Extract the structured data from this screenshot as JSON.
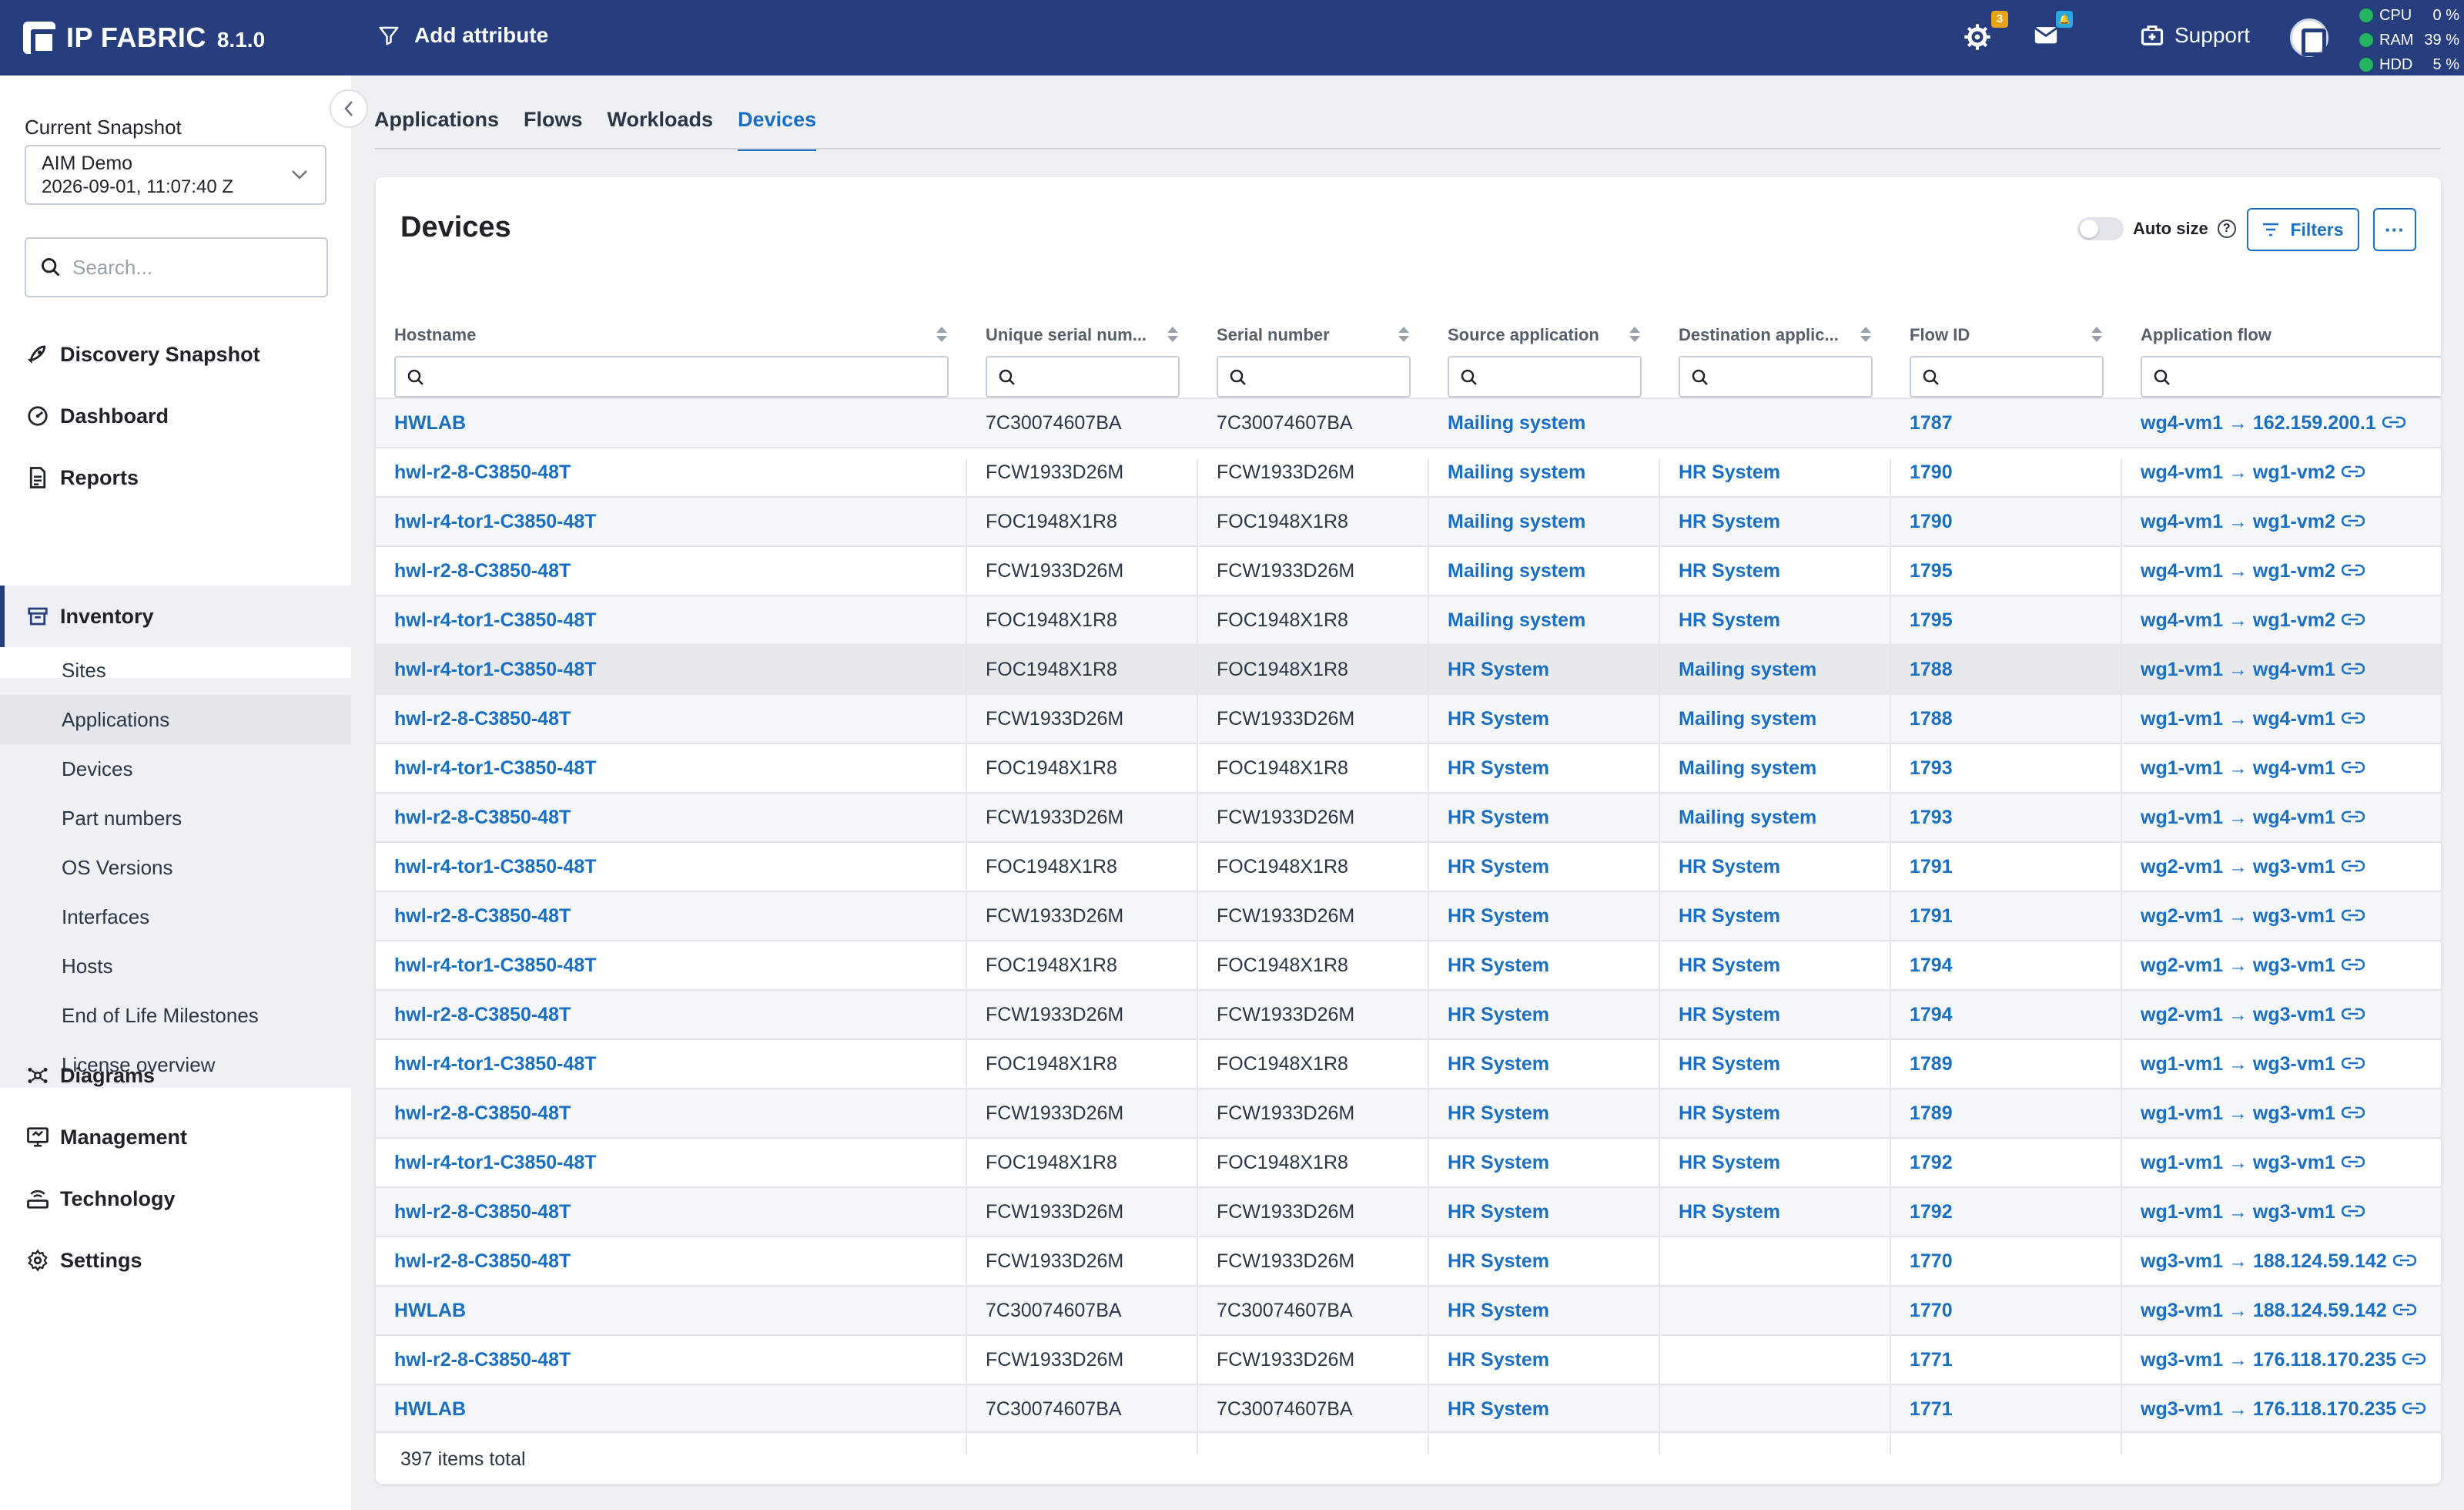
{
  "app": {
    "name": "IP FABRIC",
    "version": "8.1.0",
    "add_attribute": "Add attribute",
    "support": "Support",
    "settings_badge": "3",
    "messages_badge": "🔔",
    "stats": [
      {
        "label": "CPU",
        "value": "0 %"
      },
      {
        "label": "RAM",
        "value": "39 %"
      },
      {
        "label": "HDD",
        "value": "5 %"
      }
    ]
  },
  "sidebar": {
    "snapshot_label": "Current Snapshot",
    "snapshot_name": "AIM Demo",
    "snapshot_date": "2026-09-01, 11:07:40 Z",
    "search_placeholder": "Search...",
    "nav": [
      {
        "label": "Discovery Snapshot",
        "icon": "rocket-icon"
      },
      {
        "label": "Dashboard",
        "icon": "dashboard-icon"
      },
      {
        "label": "Reports",
        "icon": "report-icon"
      },
      {
        "label": "Inventory",
        "icon": "archive-icon"
      },
      {
        "label": "Diagrams",
        "icon": "diagram-icon"
      },
      {
        "label": "Management",
        "icon": "monitor-icon"
      },
      {
        "label": "Technology",
        "icon": "router-icon"
      },
      {
        "label": "Settings",
        "icon": "gear-icon"
      }
    ],
    "inventory_items": [
      "Sites",
      "Applications",
      "Devices",
      "Part numbers",
      "OS Versions",
      "Interfaces",
      "Hosts",
      "End of Life Milestones",
      "License overview"
    ]
  },
  "tabs": [
    "Applications",
    "Flows",
    "Workloads",
    "Devices"
  ],
  "card": {
    "title": "Devices",
    "auto_size": "Auto size",
    "filters": "Filters",
    "more": "···",
    "footer": "397 items total"
  },
  "table": {
    "columns": [
      "Hostname",
      "Unique serial num...",
      "Serial number",
      "Source application",
      "Destination applic...",
      "Flow ID",
      "Application flow"
    ],
    "rows": [
      [
        "HWLAB",
        "7C30074607BA",
        "7C30074607BA",
        "Mailing system",
        "",
        "1787",
        "wg4-vm1 → 162.159.200.1"
      ],
      [
        "hwl-r2-8-C3850-48T",
        "FCW1933D26M",
        "FCW1933D26M",
        "Mailing system",
        "HR System",
        "1790",
        "wg4-vm1 → wg1-vm2"
      ],
      [
        "hwl-r4-tor1-C3850-48T",
        "FOC1948X1R8",
        "FOC1948X1R8",
        "Mailing system",
        "HR System",
        "1790",
        "wg4-vm1 → wg1-vm2"
      ],
      [
        "hwl-r2-8-C3850-48T",
        "FCW1933D26M",
        "FCW1933D26M",
        "Mailing system",
        "HR System",
        "1795",
        "wg4-vm1 → wg1-vm2"
      ],
      [
        "hwl-r4-tor1-C3850-48T",
        "FOC1948X1R8",
        "FOC1948X1R8",
        "Mailing system",
        "HR System",
        "1795",
        "wg4-vm1 → wg1-vm2"
      ],
      [
        "hwl-r4-tor1-C3850-48T",
        "FOC1948X1R8",
        "FOC1948X1R8",
        "HR System",
        "Mailing system",
        "1788",
        "wg1-vm1 → wg4-vm1"
      ],
      [
        "hwl-r2-8-C3850-48T",
        "FCW1933D26M",
        "FCW1933D26M",
        "HR System",
        "Mailing system",
        "1788",
        "wg1-vm1 → wg4-vm1"
      ],
      [
        "hwl-r4-tor1-C3850-48T",
        "FOC1948X1R8",
        "FOC1948X1R8",
        "HR System",
        "Mailing system",
        "1793",
        "wg1-vm1 → wg4-vm1"
      ],
      [
        "hwl-r2-8-C3850-48T",
        "FCW1933D26M",
        "FCW1933D26M",
        "HR System",
        "Mailing system",
        "1793",
        "wg1-vm1 → wg4-vm1"
      ],
      [
        "hwl-r4-tor1-C3850-48T",
        "FOC1948X1R8",
        "FOC1948X1R8",
        "HR System",
        "HR System",
        "1791",
        "wg2-vm1 → wg3-vm1"
      ],
      [
        "hwl-r2-8-C3850-48T",
        "FCW1933D26M",
        "FCW1933D26M",
        "HR System",
        "HR System",
        "1791",
        "wg2-vm1 → wg3-vm1"
      ],
      [
        "hwl-r4-tor1-C3850-48T",
        "FOC1948X1R8",
        "FOC1948X1R8",
        "HR System",
        "HR System",
        "1794",
        "wg2-vm1 → wg3-vm1"
      ],
      [
        "hwl-r2-8-C3850-48T",
        "FCW1933D26M",
        "FCW1933D26M",
        "HR System",
        "HR System",
        "1794",
        "wg2-vm1 → wg3-vm1"
      ],
      [
        "hwl-r4-tor1-C3850-48T",
        "FOC1948X1R8",
        "FOC1948X1R8",
        "HR System",
        "HR System",
        "1789",
        "wg1-vm1 → wg3-vm1"
      ],
      [
        "hwl-r2-8-C3850-48T",
        "FCW1933D26M",
        "FCW1933D26M",
        "HR System",
        "HR System",
        "1789",
        "wg1-vm1 → wg3-vm1"
      ],
      [
        "hwl-r4-tor1-C3850-48T",
        "FOC1948X1R8",
        "FOC1948X1R8",
        "HR System",
        "HR System",
        "1792",
        "wg1-vm1 → wg3-vm1"
      ],
      [
        "hwl-r2-8-C3850-48T",
        "FCW1933D26M",
        "FCW1933D26M",
        "HR System",
        "HR System",
        "1792",
        "wg1-vm1 → wg3-vm1"
      ],
      [
        "hwl-r2-8-C3850-48T",
        "FCW1933D26M",
        "FCW1933D26M",
        "HR System",
        "",
        "1770",
        "wg3-vm1 → 188.124.59.142"
      ],
      [
        "HWLAB",
        "7C30074607BA",
        "7C30074607BA",
        "HR System",
        "",
        "1770",
        "wg3-vm1 → 188.124.59.142"
      ],
      [
        "hwl-r2-8-C3850-48T",
        "FCW1933D26M",
        "FCW1933D26M",
        "HR System",
        "",
        "1771",
        "wg3-vm1 → 176.118.170.235"
      ],
      [
        "HWLAB",
        "7C30074607BA",
        "7C30074607BA",
        "HR System",
        "",
        "1771",
        "wg3-vm1 → 176.118.170.235"
      ]
    ]
  }
}
